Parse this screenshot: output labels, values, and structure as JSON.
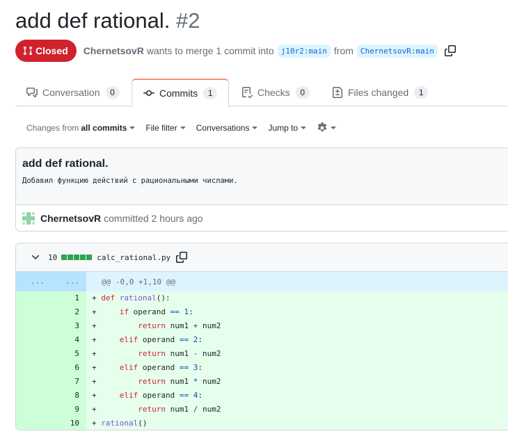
{
  "pr": {
    "title": "add def rational.",
    "number": "#2",
    "status": "Closed",
    "author": "ChernetsovR",
    "merge_text": "wants to merge 1 commit into",
    "base_branch": "j10r2:main",
    "from_text": "from",
    "head_branch": "ChernetsovR:main"
  },
  "tabs": [
    {
      "label": "Conversation",
      "count": "0"
    },
    {
      "label": "Commits",
      "count": "1"
    },
    {
      "label": "Checks",
      "count": "0"
    },
    {
      "label": "Files changed",
      "count": "1"
    }
  ],
  "filters": {
    "changes_prefix": "Changes from",
    "changes_value": "all commits",
    "file_filter": "File filter",
    "conversations": "Conversations",
    "jump_to": "Jump to"
  },
  "commit": {
    "title": "add def rational.",
    "body": "Добавил функцию действий с рациональными числами.",
    "author": "ChernetsovR",
    "committed_text": "committed 2 hours ago"
  },
  "file": {
    "changes": "10",
    "name": "calc_rational.py",
    "hunk_left": "...",
    "hunk_right": "...",
    "hunk_header": "@@ -0,0 +1,10 @@",
    "lines": [
      {
        "num": "1",
        "code": "+ def rational():"
      },
      {
        "num": "2",
        "code": "+     if operand == 1:"
      },
      {
        "num": "3",
        "code": "+         return num1 + num2"
      },
      {
        "num": "4",
        "code": "+     elif operand == 2:"
      },
      {
        "num": "5",
        "code": "+         return num1 - num2"
      },
      {
        "num": "6",
        "code": "+     elif operand == 3:"
      },
      {
        "num": "7",
        "code": "+         return num1 * num2"
      },
      {
        "num": "8",
        "code": "+     elif operand == 4:"
      },
      {
        "num": "9",
        "code": "+         return num1 / num2"
      },
      {
        "num": "10",
        "code": "+ rational()"
      }
    ]
  },
  "colors": {
    "closed": "#cf222e",
    "added_bg": "#e6ffec",
    "added_num_bg": "#ccffd8",
    "hunk_bg": "#ddf4ff",
    "accent_tab": "#fd8c73"
  }
}
